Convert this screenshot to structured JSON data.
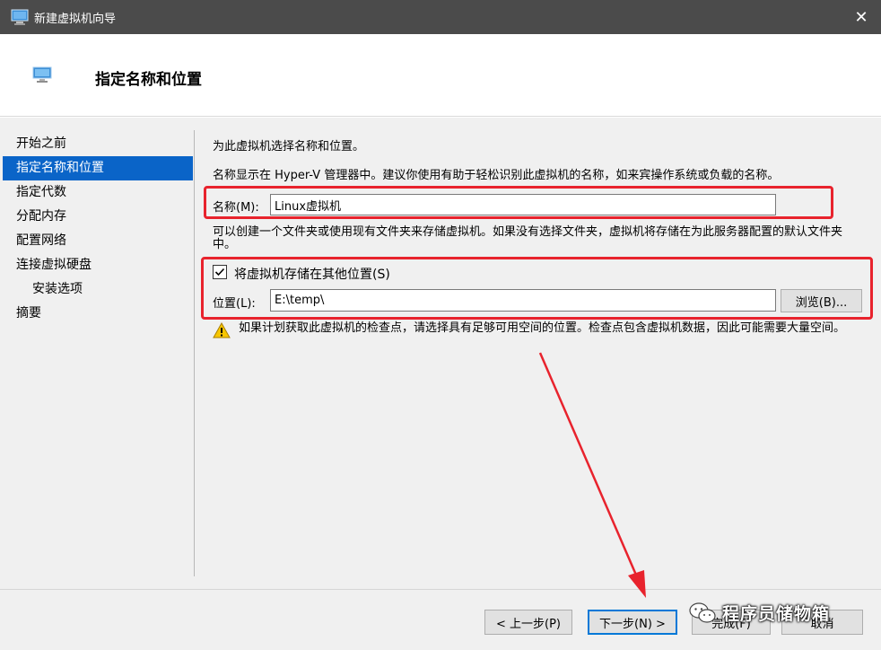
{
  "window": {
    "title": "新建虚拟机向导",
    "close_symbol": "✕"
  },
  "banner": {
    "heading": "指定名称和位置"
  },
  "nav": {
    "items": [
      {
        "label": "开始之前"
      },
      {
        "label": "指定名称和位置"
      },
      {
        "label": "指定代数"
      },
      {
        "label": "分配内存"
      },
      {
        "label": "配置网络"
      },
      {
        "label": "连接虚拟硬盘"
      },
      {
        "label": "安装选项"
      },
      {
        "label": "摘要"
      }
    ],
    "active_index": 1
  },
  "content": {
    "intro": "为此虚拟机选择名称和位置。",
    "name_hint": "名称显示在 Hyper-V 管理器中。建议你使用有助于轻松识别此虚拟机的名称，如来宾操作系统或负载的名称。",
    "name_label": "名称(M):",
    "name_value": "Linux虚拟机",
    "folder_hint": "可以创建一个文件夹或使用现有文件夹来存储虚拟机。如果没有选择文件夹，虚拟机将存储在为此服务器配置的默认文件夹中。",
    "store_elsewhere_label": "将虚拟机存储在其他位置(S)",
    "store_elsewhere_checked": true,
    "location_label": "位置(L):",
    "location_value": "E:\\temp\\",
    "browse_label": "浏览(B)...",
    "warning_text": "如果计划获取此虚拟机的检查点，请选择具有足够可用空间的位置。检查点包含虚拟机数据，因此可能需要大量空间。"
  },
  "footer": {
    "prev_label": "< 上一步(P)",
    "next_label": "下一步(N) >",
    "finish_label": "完成(F)",
    "cancel_label": "取消"
  },
  "watermark": {
    "text": "程序员储物箱"
  },
  "colors": {
    "annotation_red": "#e8232d",
    "selection_blue": "#0a64c8",
    "titlebar": "#4b4b4b"
  }
}
